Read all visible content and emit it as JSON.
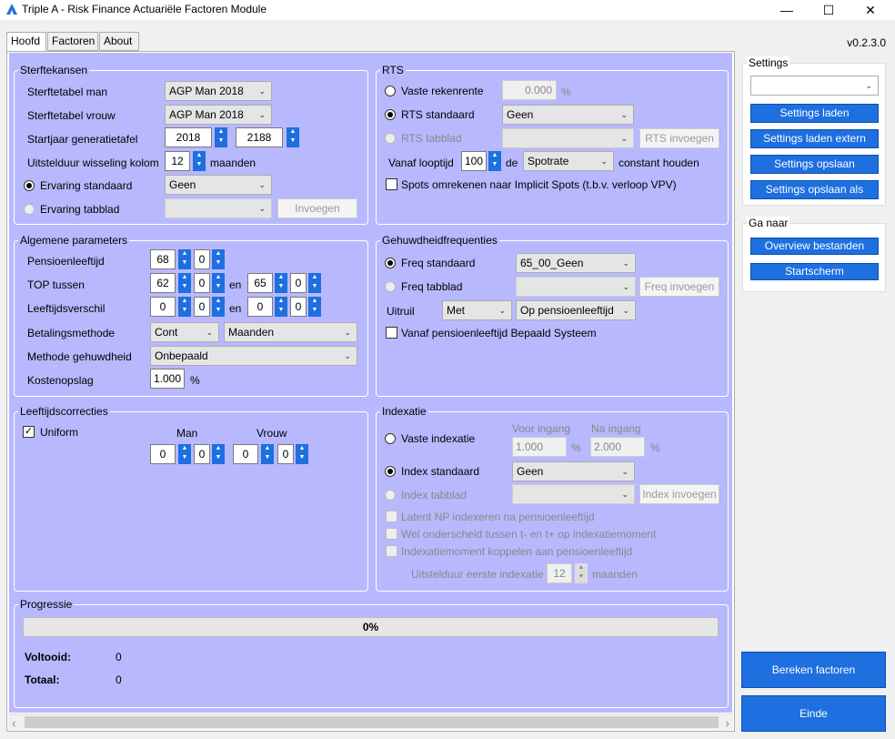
{
  "window": {
    "title": "Triple A - Risk Finance Actuariële Factoren Module",
    "minimize": "—",
    "maximize": "☐",
    "close": "✕"
  },
  "tabs": [
    "Hoofd",
    "Factoren",
    "About"
  ],
  "version": "v0.2.3.0",
  "sterfte": {
    "title": "Sterftekansen",
    "man_label": "Sterftetabel man",
    "man_value": "AGP Man 2018",
    "vrouw_label": "Sterftetabel vrouw",
    "vrouw_value": "AGP Man 2018",
    "start_label": "Startjaar generatietafel",
    "start_from": "2018",
    "start_to": "2188",
    "uitstel_label": "Uitstelduur wisseling kolom",
    "uitstel_value": "12",
    "uitstel_unit": "maanden",
    "ervaring_std": "Ervaring standaard",
    "ervaring_std_value": "Geen",
    "ervaring_tab": "Ervaring tabblad",
    "invoegen": "Invoegen"
  },
  "rts": {
    "title": "RTS",
    "vaste_label": "Vaste rekenrente",
    "vaste_value": "0.000",
    "pct": "%",
    "std_label": "RTS standaard",
    "std_value": "Geen",
    "tab_label": "RTS tabblad",
    "invoegen": "RTS invoegen",
    "vanaf_label": "Vanaf looptijd",
    "vanaf_value": "100",
    "de": "de",
    "spot_value": "Spotrate",
    "constant": "constant houden",
    "spots_label": "Spots omrekenen naar Implicit Spots (t.b.v. verloop VPV)"
  },
  "algemeen": {
    "title": "Algemene parameters",
    "pensioen_label": "Pensioenleeftijd",
    "pensioen_j": "68",
    "pensioen_m": "0",
    "top_label": "TOP tussen",
    "top_j1": "62",
    "top_m1": "0",
    "en": "en",
    "top_j2": "65",
    "top_m2": "0",
    "verschil_label": "Leeftijdsverschil",
    "verschil_j1": "0",
    "verschil_m1": "0",
    "verschil_j2": "0",
    "verschil_m2": "0",
    "betaling_label": "Betalingsmethode",
    "betaling_value": "Cont",
    "betaling_freq": "Maanden",
    "gehuwd_label": "Methode gehuwdheid",
    "gehuwd_value": "Onbepaald",
    "kosten_label": "Kostenopslag",
    "kosten_value": "1.000",
    "pct": "%"
  },
  "gehuwd": {
    "title": "Gehuwdheidfrequenties",
    "std_label": "Freq standaard",
    "std_value": "65_00_Geen",
    "tab_label": "Freq tabblad",
    "invoegen": "Freq invoegen",
    "uitruil_label": "Uitruil",
    "uitruil_value": "Met",
    "uitruil_moment": "Op pensioenleeftijd",
    "bepaald_label": "Vanaf pensioenleeftijd Bepaald Systeem"
  },
  "correcties": {
    "title": "Leeftijdscorrecties",
    "uniform": "Uniform",
    "check": "✓",
    "man": "Man",
    "vrouw": "Vrouw",
    "man_j": "0",
    "man_m": "0",
    "vrouw_j": "0",
    "vrouw_m": "0"
  },
  "indexatie": {
    "title": "Indexatie",
    "vaste_label": "Vaste indexatie",
    "voor": "Voor ingang",
    "na": "Na ingang",
    "voor_value": "1.000",
    "na_value": "2.000",
    "pct": "%",
    "std_label": "Index standaard",
    "std_value": "Geen",
    "tab_label": "Index tabblad",
    "invoegen": "Index invoegen",
    "latent": "Latent NP indexeren na pensioenleeftijd",
    "onderscheid": "Wel onderscheid tussen t- en t+ op indexatiemoment",
    "koppelen": "Indexatiemoment koppelen aan pensioenleeftijd",
    "uitstel_label": "Uitstelduur eerste indexatie",
    "uitstel_value": "12",
    "uitstel_unit": "maanden"
  },
  "progressie": {
    "title": "Progressie",
    "percent": "0%",
    "progress_fraction": 0,
    "voltooid_label": "Voltooid:",
    "voltooid_value": "0",
    "totaal_label": "Totaal:",
    "totaal_value": "0"
  },
  "settings": {
    "title": "Settings",
    "laden": "Settings laden",
    "laden_extern": "Settings laden extern",
    "opslaan": "Settings opslaan",
    "opslaan_als": "Settings opslaan als"
  },
  "ganaar": {
    "title": "Ga naar",
    "overview": "Overview bestanden",
    "start": "Startscherm"
  },
  "actions": {
    "bereken": "Bereken factoren",
    "einde": "Einde"
  },
  "scroll": {
    "left": "‹",
    "right": "›"
  },
  "glyphs": {
    "up": "▲",
    "down": "▼",
    "dropdown": "⌄"
  }
}
